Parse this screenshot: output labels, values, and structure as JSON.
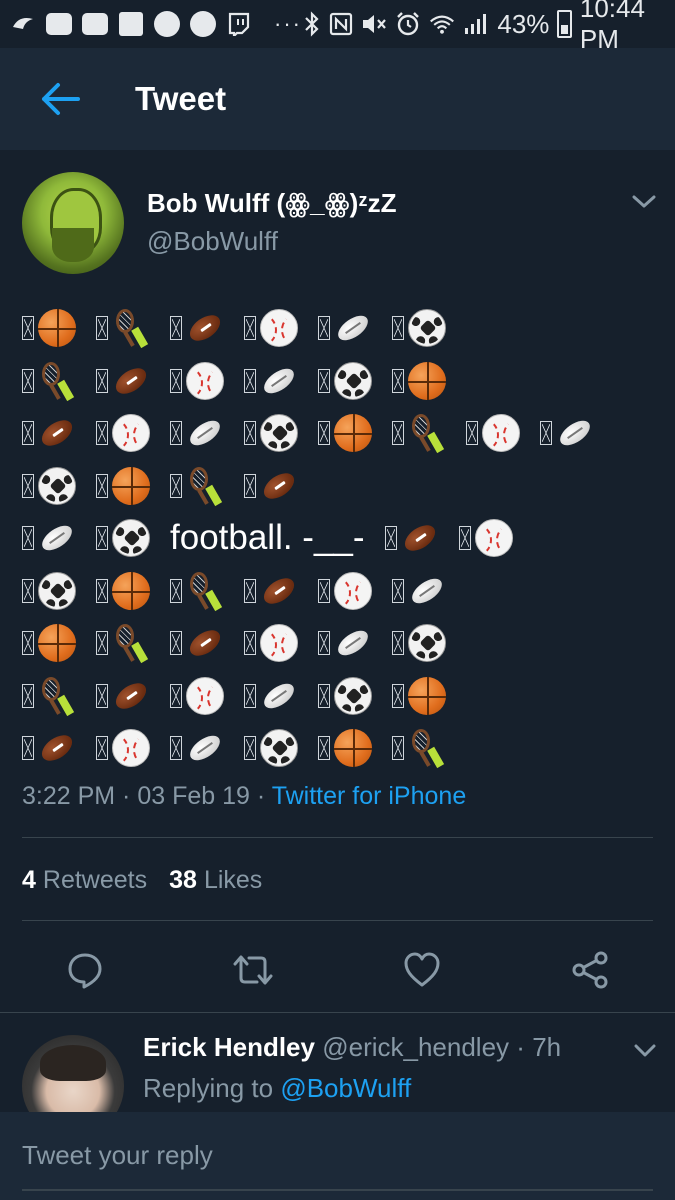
{
  "status_bar": {
    "battery": "43%",
    "time": "10:44 PM",
    "overflow": "···"
  },
  "header": {
    "title": "Tweet"
  },
  "tweet": {
    "author_name": "Bob Wulff (ꙮ_ꙮ)ᶻzZ",
    "author_handle": "@BobWulff",
    "lines": [
      [
        "basketball",
        "tennis",
        "football",
        "baseball",
        "rugby",
        "soccer"
      ],
      [
        "tennis",
        "football",
        "baseball",
        "rugby",
        "soccer",
        "basketball"
      ],
      [
        "football",
        "baseball",
        "rugby",
        "soccer",
        "basketball",
        "tennis",
        "baseball",
        "rugby"
      ],
      [
        "soccer",
        "basketball",
        "tennis",
        "football"
      ],
      [
        "rugby",
        "soccer",
        "#word",
        "football",
        "baseball"
      ],
      [
        "soccer",
        "basketball",
        "tennis",
        "football",
        "baseball",
        "rugby"
      ],
      [
        "basketball",
        "tennis",
        "football",
        "baseball",
        "rugby",
        "soccer"
      ],
      [
        "tennis",
        "football",
        "baseball",
        "rugby",
        "soccer",
        "basketball"
      ],
      [
        "football",
        "baseball",
        "rugby",
        "soccer",
        "basketball",
        "tennis"
      ]
    ],
    "inline_text": "football. -__-",
    "time": "3:22 PM",
    "date": "03 Feb 19",
    "source": "Twitter for iPhone",
    "retweets_count": "4",
    "retweets_label": "Retweets",
    "likes_count": "38",
    "likes_label": "Likes"
  },
  "reply": {
    "author_name": "Erick Hendley",
    "author_handle": "@erick_hendley",
    "age": "7h",
    "replying_prefix": "Replying to",
    "replying_to": "@BobWulff"
  },
  "compose": {
    "placeholder": "Tweet your reply"
  },
  "colors": {
    "background": "#16202c",
    "header": "#1c2938",
    "accent": "#1da1f2",
    "muted": "#8899a6",
    "divider": "#38444d"
  },
  "icons": {
    "back": "arrow-left-icon",
    "menu": "chevron-down-icon",
    "reply": "comment-icon",
    "retweet": "retweet-icon",
    "like": "heart-icon",
    "share": "share-icon"
  }
}
